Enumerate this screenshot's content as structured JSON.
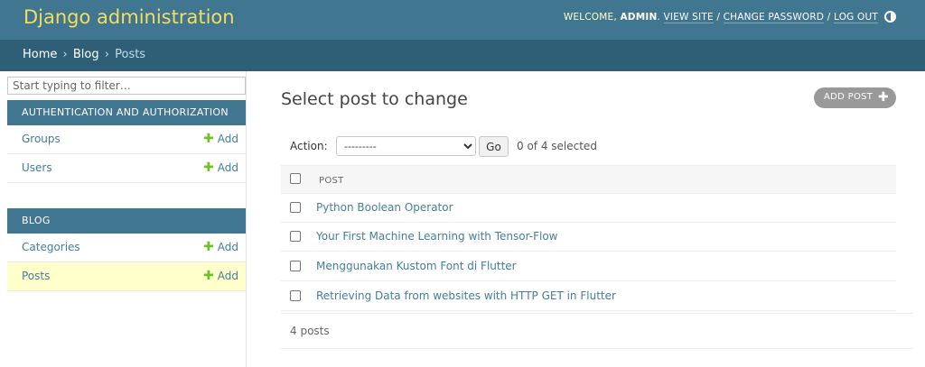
{
  "header": {
    "branding": "Django administration",
    "welcome": "WELCOME,",
    "username": "ADMIN",
    "view_site": "VIEW SITE",
    "change_password": "CHANGE PASSWORD",
    "log_out": "LOG OUT",
    "separator": " / "
  },
  "breadcrumbs": {
    "home": "Home",
    "blog": "Blog",
    "current": "Posts",
    "sep": "›"
  },
  "sidebar": {
    "filter_placeholder": "Start typing to filter…",
    "apps": [
      {
        "caption": "AUTHENTICATION AND AUTHORIZATION",
        "models": [
          {
            "name": "Groups",
            "add": "Add"
          },
          {
            "name": "Users",
            "add": "Add"
          }
        ]
      },
      {
        "caption": "BLOG",
        "models": [
          {
            "name": "Categories",
            "add": "Add"
          },
          {
            "name": "Posts",
            "add": "Add"
          }
        ]
      }
    ]
  },
  "content": {
    "title": "Select post to change",
    "add_button": "ADD POST",
    "action_label": "Action:",
    "action_selected": "---------",
    "go_label": "Go",
    "selection_count": "0 of 4 selected",
    "column_header": "POST",
    "rows": [
      "Python Boolean Operator",
      "Your First Machine Learning with Tensor-Flow",
      "Menggunakan Kustom Font di Flutter",
      "Retrieving Data from websites with HTTP GET in Flutter"
    ],
    "paginator": "4 posts"
  },
  "colors": {
    "header_bg": "#417690",
    "breadcrumb_bg": "#2f5f76",
    "branding": "#f5dd5d",
    "link": "#447e9b",
    "add_plus": "#70bf2b",
    "current_row": "#ffffcc"
  }
}
